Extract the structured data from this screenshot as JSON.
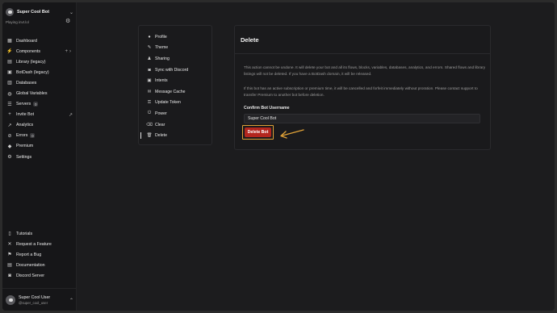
{
  "bot": {
    "name": "Super Cool Bot",
    "status": "Playing invt.lol"
  },
  "sidebar": {
    "items": [
      {
        "label": "Dashboard",
        "icon": "grid-icon"
      },
      {
        "label": "Components",
        "icon": "bolt-icon"
      },
      {
        "label": "Library (legacy)",
        "icon": "library-icon"
      },
      {
        "label": "BotDash (legacy)",
        "icon": "terminal-icon"
      },
      {
        "label": "Databases",
        "icon": "database-icon"
      },
      {
        "label": "Global Variables",
        "icon": "globe-icon"
      },
      {
        "label": "Servers",
        "icon": "server-icon",
        "badge": "0"
      },
      {
        "label": "Invite Bot",
        "icon": "plus-icon"
      },
      {
        "label": "Analytics",
        "icon": "chart-icon"
      },
      {
        "label": "Errors",
        "icon": "error-icon",
        "badge": "0"
      },
      {
        "label": "Premium",
        "icon": "premium-icon"
      },
      {
        "label": "Settings",
        "icon": "gear-icon"
      }
    ],
    "bottom_items": [
      {
        "label": "Tutorials",
        "icon": "book-icon"
      },
      {
        "label": "Request a Feature",
        "icon": "tools-icon"
      },
      {
        "label": "Report a Bug",
        "icon": "flag-icon"
      },
      {
        "label": "Documentation",
        "icon": "doc-icon"
      },
      {
        "label": "Discord Server",
        "icon": "discord-icon"
      }
    ]
  },
  "user": {
    "name": "Super Cool User",
    "handle": "@super_cool_user"
  },
  "settings_menu": {
    "items": [
      {
        "label": "Profile",
        "icon": "profile-icon"
      },
      {
        "label": "Theme",
        "icon": "palette-icon"
      },
      {
        "label": "Sharing",
        "icon": "users-icon"
      },
      {
        "label": "Sync with Discord",
        "icon": "sync-icon"
      },
      {
        "label": "Intents",
        "icon": "intents-icon"
      },
      {
        "label": "Message Cache",
        "icon": "cache-icon"
      },
      {
        "label": "Update Token",
        "icon": "key-icon"
      },
      {
        "label": "Power",
        "icon": "power-icon"
      },
      {
        "label": "Clear",
        "icon": "eraser-icon"
      },
      {
        "label": "Delete",
        "icon": "trash-icon",
        "active": true
      }
    ]
  },
  "delete_panel": {
    "title": "Delete",
    "paragraph1": "This action cannot be undone. It will delete your bot and all its flows, blocks, variables, databases, analytics, and errors. Shared flows and library listings will not be deleted. If you have a BotDash domain, it will be released.",
    "paragraph2": "If this bot has an active subscription or premium time, it will be cancelled and forfeit immediately without proration. Please contact support to transfer Premium to another bot before deletion.",
    "confirm_label": "Confirm Bot Username",
    "confirm_value": "Super Cool Bot",
    "button_label": "Delete Bot"
  },
  "colors": {
    "danger": "#b3261e",
    "highlight": "#e0a238",
    "background": "#1c1c1e"
  }
}
